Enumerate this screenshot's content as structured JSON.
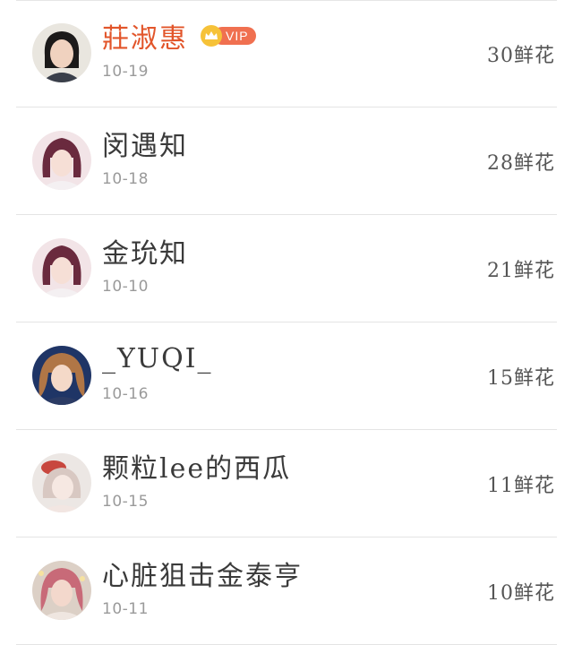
{
  "list": [
    {
      "name": "莊淑惠",
      "vip": true,
      "vip_badge": "VIP",
      "date": "10-19",
      "flowers": "30鲜花",
      "avatar_colors": {
        "bg": "#e9e6df",
        "hair": "#1c1a1a",
        "face": "#f0d2bf",
        "cloth": "#3a3f4a"
      }
    },
    {
      "name": "闵遇知",
      "vip": false,
      "date": "10-18",
      "flowers": "28鲜花",
      "avatar_colors": {
        "bg": "#f2e4e7",
        "hair": "#6a2a3e",
        "face": "#f6dfd6",
        "cloth": "#f4f0f2"
      }
    },
    {
      "name": "金玧知",
      "vip": false,
      "date": "10-10",
      "flowers": "21鲜花",
      "avatar_colors": {
        "bg": "#f2e4e7",
        "hair": "#6a2a3e",
        "face": "#f6dfd6",
        "cloth": "#f4f0f2"
      }
    },
    {
      "name": "_YUQI_",
      "vip": false,
      "date": "10-16",
      "flowers": "15鲜花",
      "avatar_colors": {
        "bg": "#1f3566",
        "hair": "#b07646",
        "face": "#f4d9c8",
        "cloth": "#2b3b64"
      }
    },
    {
      "name": "颗粒lee的西瓜",
      "vip": false,
      "date": "10-15",
      "flowers": "11鲜花",
      "avatar_colors": {
        "bg": "#ece7e4",
        "hair": "#d8c8c2",
        "face": "#f6e8e2",
        "cloth": "#c8473e"
      }
    },
    {
      "name": "心脏狙击金泰亨",
      "vip": false,
      "date": "10-11",
      "flowers": "10鲜花",
      "avatar_colors": {
        "bg": "#dcd0c6",
        "hair": "#c86a78",
        "face": "#f3d8cc",
        "cloth": "#efe6e0"
      }
    }
  ]
}
